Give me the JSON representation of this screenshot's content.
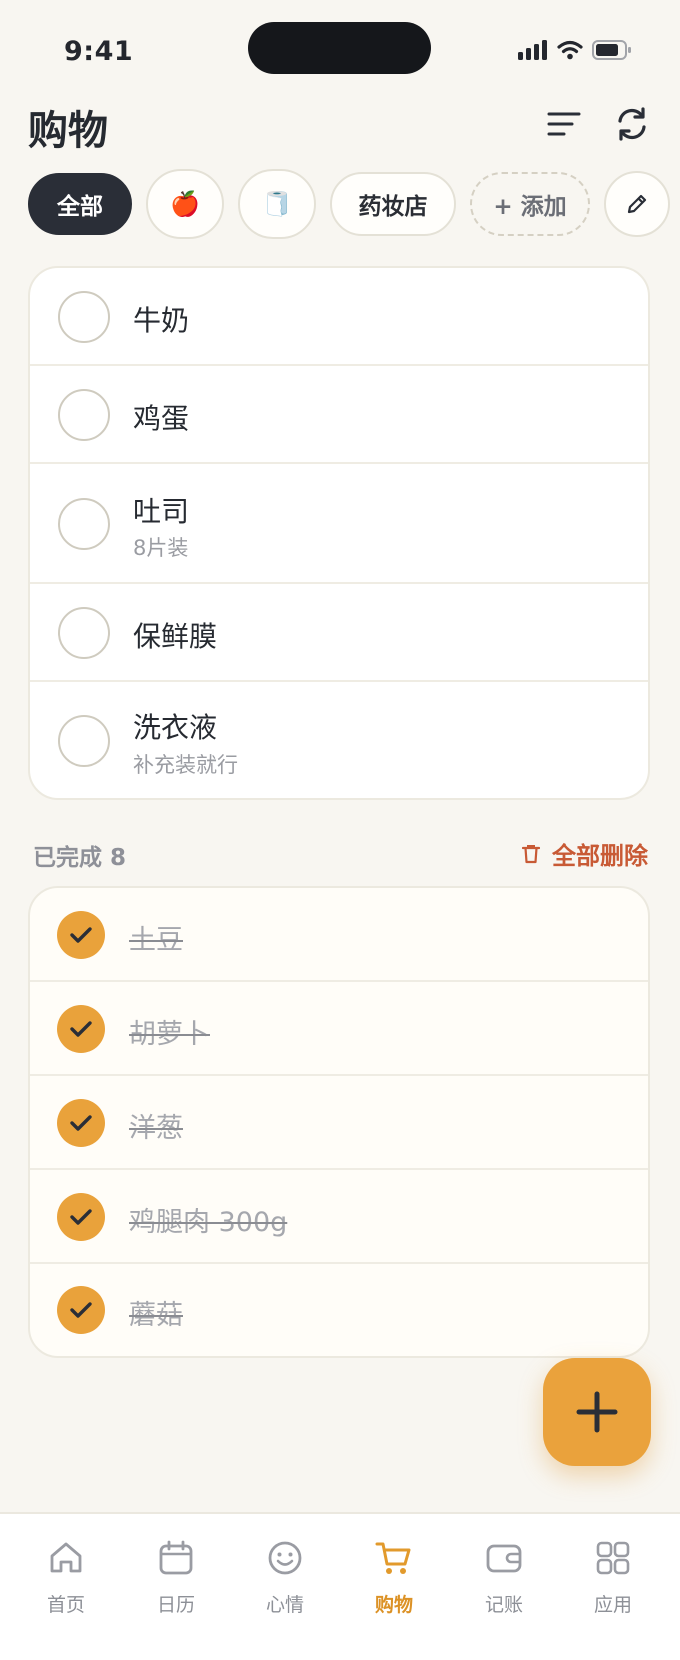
{
  "status_bar": {
    "time": "9:41"
  },
  "header": {
    "title": "购物"
  },
  "filters": {
    "all": "全部",
    "fruit_emoji": "🍎",
    "tissue_emoji": "🧻",
    "pharmacy": "药妆店",
    "add": "+ 添加"
  },
  "pending": [
    {
      "name": "牛奶",
      "note": ""
    },
    {
      "name": "鸡蛋",
      "note": ""
    },
    {
      "name": "吐司",
      "note": "8片装"
    },
    {
      "name": "保鲜膜",
      "note": ""
    },
    {
      "name": "洗衣液",
      "note": "补充装就行"
    }
  ],
  "completed": {
    "label": "已完成 8",
    "delete_all": "全部删除",
    "items": [
      "土豆",
      "胡萝卜",
      "洋葱",
      "鸡腿肉 300g",
      "蘑菇"
    ]
  },
  "tabs": [
    {
      "label": "首页",
      "icon": "home-icon"
    },
    {
      "label": "日历",
      "icon": "calendar-icon"
    },
    {
      "label": "心情",
      "icon": "smile-icon"
    },
    {
      "label": "购物",
      "icon": "cart-icon",
      "active": true
    },
    {
      "label": "记账",
      "icon": "wallet-icon"
    },
    {
      "label": "应用",
      "icon": "apps-icon"
    }
  ],
  "colors": {
    "accent": "#e9a23b",
    "active_chip": "#2a2e37",
    "danger": "#c85a35",
    "background": "#f8f6f1"
  }
}
